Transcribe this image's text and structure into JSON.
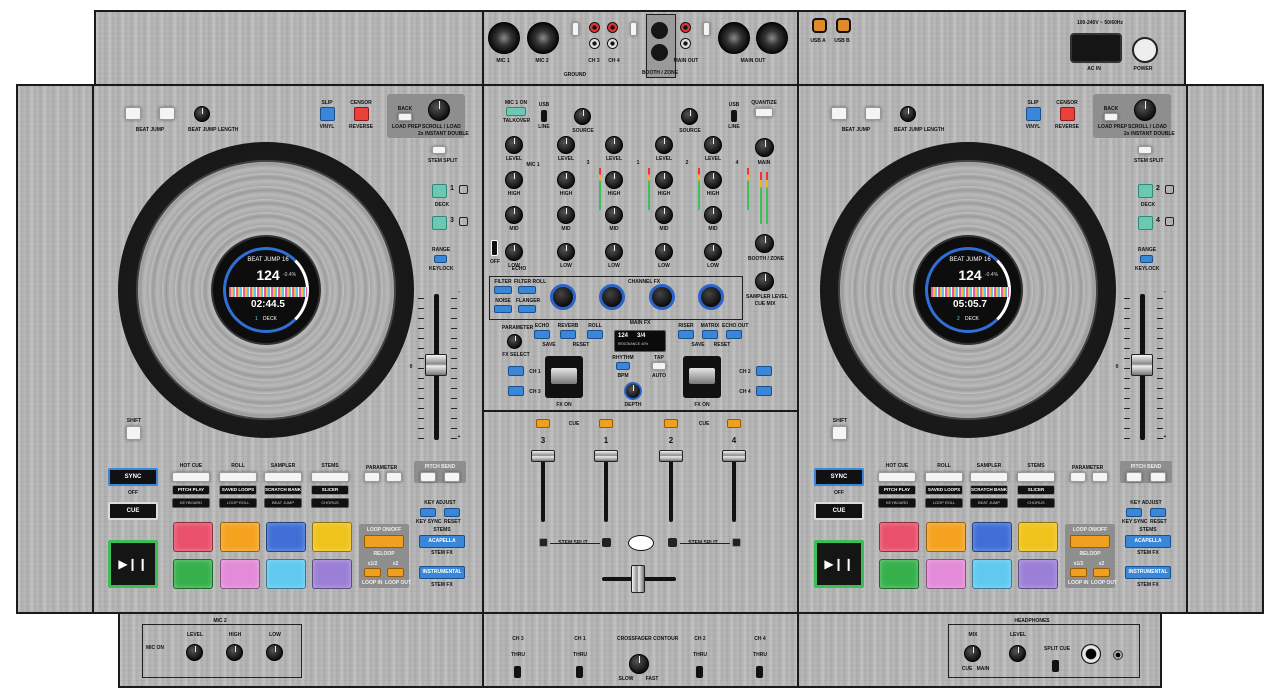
{
  "top_panel": {
    "left_inputs": {
      "mic1": "MIC 1",
      "mic2": "MIC 2",
      "ground": "GROUND",
      "phono": "PHONO",
      "line": "LINE",
      "ch3": "CH 3",
      "ch4": "CH 4"
    },
    "booth_zone": "BOOTH / ZONE",
    "main_out_rca": "MAIN OUT",
    "main_out_xlr": "MAIN OUT",
    "usb_labels": [
      "USB A",
      "USB B"
    ],
    "ac_in": "AC IN",
    "ac_rating": "100-240V ~ 50/60Hz",
    "power": "POWER"
  },
  "decks": [
    {
      "side": "left",
      "beat_jump": "BEAT JUMP",
      "beat_jump_length": "BEAT JUMP LENGTH",
      "slip": "SLIP",
      "vinyl": "VINYL",
      "censor": "CENSOR",
      "reverse": "REVERSE",
      "back": "BACK",
      "load_prep": "LOAD PREP",
      "scroll_load": "SCROLL / LOAD",
      "instant_double": "2x INSTANT DOUBLE",
      "stem_split": "STEM SPLIT",
      "deck_numbers": [
        "1",
        "3"
      ],
      "deck_label": "DECK",
      "range": "RANGE",
      "keylock": "KEYLOCK",
      "shift": "SHIFT",
      "screen": {
        "title": "BEAT JUMP 16",
        "bpm": "124",
        "time": "02:44.5",
        "deck": "DECK",
        "deck_num": "1",
        "pitch": "-0.4%"
      },
      "pitch_scale": [
        "-",
        "0",
        "+"
      ],
      "sync": "SYNC",
      "off": "OFF",
      "cue": "CUE",
      "pad_modes_top": [
        "HOT CUE",
        "ROLL",
        "SAMPLER",
        "STEMS"
      ],
      "pad_modes": [
        "PITCH PLAY",
        "SAVED LOOPS",
        "SCRATCH BANK",
        "SLICER"
      ],
      "pad_modes_sub": [
        "KEYBOARD",
        "LOOP ROLL",
        "BEAT JUMP",
        "CHORUS"
      ],
      "parameter": "PARAMETER",
      "pitch_bend": "PITCH BEND",
      "key_adjust": "KEY ADJUST",
      "key_sync": "KEY SYNC",
      "reset": "RESET",
      "stems": "STEMS",
      "acapella": "ACAPELLA",
      "stem_fx": "STEM FX",
      "instrumental": "INSTRUMENTAL",
      "loop_on_off": "LOOP ON/OFF",
      "reloop": "RELOOP",
      "loop_half": "x1/2",
      "loop_double": "x2",
      "loop_in": "LOOP IN",
      "loop_out": "LOOP OUT",
      "pad_colors": [
        "#e9506b",
        "#f5a21f",
        "#3f6fd6",
        "#efc31c",
        "#36b04a",
        "#e38ad8",
        "#5fc9f0",
        "#9b7fd6"
      ]
    },
    {
      "side": "right",
      "beat_jump": "BEAT JUMP",
      "beat_jump_length": "BEAT JUMP LENGTH",
      "slip": "SLIP",
      "vinyl": "VINYL",
      "censor": "CENSOR",
      "reverse": "REVERSE",
      "back": "BACK",
      "load_prep": "LOAD PREP",
      "scroll_load": "SCROLL / LOAD",
      "instant_double": "2x INSTANT DOUBLE",
      "stem_split": "STEM SPLIT",
      "deck_numbers": [
        "2",
        "4"
      ],
      "deck_label": "DECK",
      "range": "RANGE",
      "keylock": "KEYLOCK",
      "shift": "SHIFT",
      "screen": {
        "title": "BEAT JUMP 16",
        "bpm": "124",
        "time": "05:05.7",
        "deck": "DECK",
        "deck_num": "2",
        "pitch": "-0.4%"
      },
      "pitch_scale": [
        "-",
        "0",
        "+"
      ],
      "sync": "SYNC",
      "off": "OFF",
      "cue": "CUE",
      "pad_modes_top": [
        "HOT CUE",
        "ROLL",
        "SAMPLER",
        "STEMS"
      ],
      "pad_modes": [
        "PITCH PLAY",
        "SAVED LOOPS",
        "SCRATCH BANK",
        "SLICER"
      ],
      "pad_modes_sub": [
        "KEYBOARD",
        "LOOP ROLL",
        "BEAT JUMP",
        "CHORUS"
      ],
      "parameter": "PARAMETER",
      "pitch_bend": "PITCH BEND",
      "key_adjust": "KEY ADJUST",
      "key_sync": "KEY SYNC",
      "reset": "RESET",
      "stems": "STEMS",
      "acapella": "ACAPELLA",
      "stem_fx": "STEM FX",
      "instrumental": "INSTRUMENTAL",
      "loop_on_off": "LOOP ON/OFF",
      "reloop": "RELOOP",
      "loop_half": "x1/2",
      "loop_double": "x2",
      "loop_in": "LOOP IN",
      "loop_out": "LOOP OUT",
      "pad_colors": [
        "#e9506b",
        "#f5a21f",
        "#3f6fd6",
        "#efc31c",
        "#36b04a",
        "#e38ad8",
        "#5fc9f0",
        "#9b7fd6"
      ]
    }
  ],
  "mixer": {
    "mic_on": "MIC 1 ON",
    "talkover": "TALKOVER",
    "usb": "USB",
    "line": "LINE",
    "source": "SOURCE",
    "quantize": "QUANTIZE",
    "level": "LEVEL",
    "mic1": "MIC 1",
    "high": "HIGH",
    "mid": "MID",
    "low": "LOW",
    "echo": "ECHO",
    "off": "OFF",
    "gain": "GAIN",
    "main": "MAIN",
    "booth_zone": "BOOTH / ZONE",
    "sampler_level": "SAMPLER LEVEL",
    "cue_mix": "CUE MIX",
    "channel_numbers": [
      "3",
      "1",
      "2",
      "4"
    ],
    "filter": "FILTER",
    "filter_roll": "FILTER ROLL",
    "noise": "NOISE",
    "flanger": "FLANGER",
    "channel_fx": "CHANNEL FX",
    "parameter": "PARAMETER",
    "main_fx": "MAIN FX",
    "fx_select": "FX SELECT",
    "echo_btn": "ECHO",
    "reverb": "REVERB",
    "roll": "ROLL",
    "riser": "RISER",
    "mattix": "MATRIX",
    "echo_out": "ECHO OUT",
    "fx_screen": {
      "bpm": "124",
      "beats": "3/4",
      "label": "RESONANCE 40%"
    },
    "save": "SAVE",
    "reset": "RESET",
    "bpm": "BPM",
    "rhythm": "RHYTHM",
    "tap": "TAP",
    "auto": "AUTO",
    "depth": "DEPTH",
    "ch_buttons_left": [
      "CH 1",
      "CH 3"
    ],
    "ch_buttons_right": [
      "CH 2",
      "CH 4"
    ],
    "fx_on": "FX ON",
    "cue": "CUE",
    "fader_numbers": [
      "3",
      "1",
      "2",
      "4"
    ],
    "stem_split": "STEM SPLIT"
  },
  "front_panel": {
    "mic2": "MIC 2",
    "level": "LEVEL",
    "high": "HIGH",
    "low": "LOW",
    "mic_on": "MIC ON",
    "ch3": "CH 3",
    "ch1": "CH 1",
    "crossfader_contour": "CROSSFADER CONTOUR",
    "ch2": "CH 2",
    "ch4": "CH 4",
    "thru": "THRU",
    "slow": "SLOW",
    "fast": "FAST",
    "headphones": "HEADPHONES",
    "mix": "MIX",
    "split_cue": "SPLIT CUE",
    "cue": "CUE",
    "main": "MAIN"
  },
  "colors": {
    "wood": "#b9b9b9",
    "blue": "#3a86d8",
    "teal": "#6cc8b4",
    "red": "#e8403a",
    "orange": "#f0a020",
    "outline": "#1a1a1a"
  }
}
